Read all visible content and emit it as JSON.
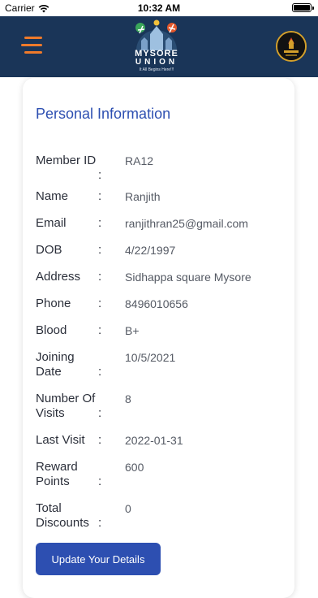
{
  "status_bar": {
    "carrier": "Carrier",
    "time": "10:32 AM"
  },
  "header": {
    "logo_title": "MYSORE",
    "logo_sub": "UNION",
    "logo_tagline": "It All Begins Here!!!"
  },
  "card": {
    "title": "Personal Information",
    "fields": [
      {
        "label": "Member ID",
        "value": "RA12"
      },
      {
        "label": "Name",
        "value": "Ranjith"
      },
      {
        "label": "Email",
        "value": "ranjithran25@gmail.com"
      },
      {
        "label": "DOB",
        "value": "4/22/1997"
      },
      {
        "label": "Address",
        "value": "Sidhappa square Mysore"
      },
      {
        "label": "Phone",
        "value": "8496010656"
      },
      {
        "label": "Blood",
        "value": "B+"
      },
      {
        "label": "Joining Date",
        "value": "10/5/2021"
      },
      {
        "label": "Number Of Visits",
        "value": "8"
      },
      {
        "label": "Last Visit",
        "value": "2022-01-31"
      },
      {
        "label": "Reward Points",
        "value": "600"
      },
      {
        "label": "Total Discounts",
        "value": "0"
      }
    ],
    "update_button": "Update Your Details"
  },
  "colors": {
    "header_bg": "#1a3558",
    "menu_accent": "#ef7a2a",
    "title_blue": "#2d4fb1",
    "button_bg": "#2d4fb1"
  },
  "icons": {
    "menu": "hamburger-menu-icon",
    "wifi": "wifi-icon",
    "battery": "battery-icon",
    "profile": "profile-avatar"
  }
}
